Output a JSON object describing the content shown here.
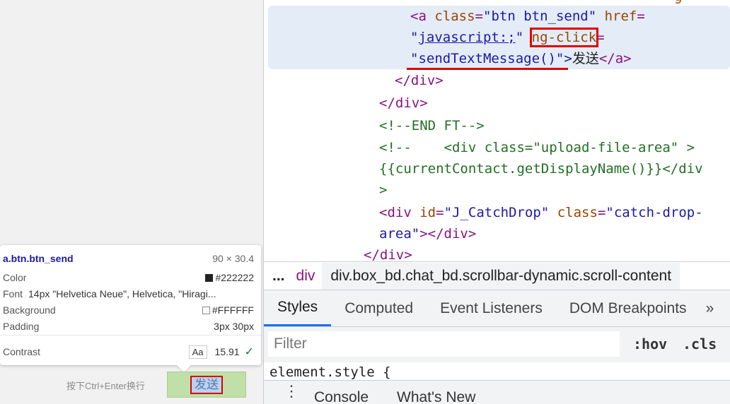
{
  "tooltip": {
    "selector": "a.btn.btn_send",
    "dimensions": "90 × 30.4",
    "color_label": "Color",
    "color_value": "#222222",
    "color_swatch": "#222222",
    "font_label": "Font",
    "font_value": "14px \"Helvetica Neue\", Helvetica, \"Hiragi...",
    "background_label": "Background",
    "background_value": "#FFFFFF",
    "background_swatch": "#FFFFFF",
    "padding_label": "Padding",
    "padding_value": "3px 30px",
    "contrast_label": "Contrast",
    "contrast_aa": "Aa",
    "contrast_value": "15.91"
  },
  "page": {
    "hint": "按下Ctrl+Enter换行",
    "send_label": "发送"
  },
  "elements": {
    "l0_attr": "g",
    "l1_open": "<a",
    "l1_class_attr": "class",
    "l1_class_val": "\"btn btn_send\"",
    "l1_href_attr": "href",
    "l2_quote_open": "\"",
    "l2_href_val": "javascript:;",
    "l2_quote_close": "\"",
    "l2_ngclick_attr": "ng-click",
    "l2_eq": "=",
    "l3_quote_open": "\"",
    "l3_ngclick_val": "sendTextMessage()",
    "l3_quote_close": "\">",
    "l3_text": "发送",
    "l3_close": "</a>",
    "l4": "</div>",
    "l5": "</div>",
    "l6": "<!--END FT-->",
    "l7": "<!--    <div class=\"upload-file-area\" >",
    "l8": "{{currentContact.getDisplayName()}}</div",
    "l9": ">",
    "l10_open": "<div",
    "l10_id_attr": "id",
    "l10_id_val": "\"J_CatchDrop\"",
    "l10_class_attr": "class",
    "l10_class_val": "\"catch-drop-",
    "l11_val": "area\"",
    "l11_close": "></div>",
    "l12": "</div>"
  },
  "breadcrumb": {
    "dots": "...",
    "item1": "div",
    "item2": "div.box_bd.chat_bd.scrollbar-dynamic.scroll-content"
  },
  "tabs": {
    "styles": "Styles",
    "computed": "Computed",
    "event_listeners": "Event Listeners",
    "dom_breakpoints": "DOM Breakpoints",
    "more": "»"
  },
  "filter": {
    "placeholder": "Filter",
    "hov": ":hov",
    "cls": ".cls"
  },
  "styles_pane": {
    "element_style": "element.style {"
  },
  "drawer": {
    "console": "Console",
    "whats_new": "What's New"
  }
}
